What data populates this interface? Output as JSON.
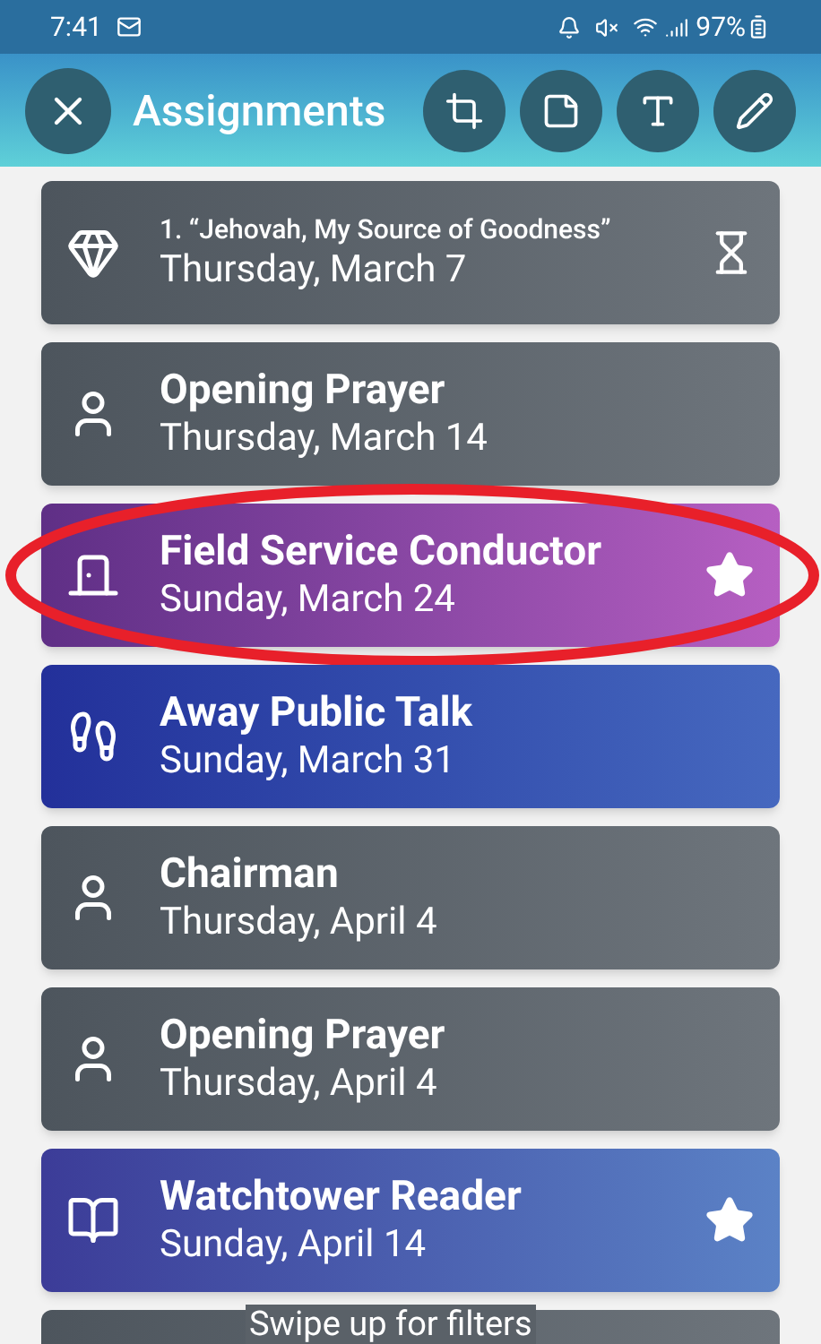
{
  "status_bar": {
    "time": "7:41",
    "battery": "97%"
  },
  "header": {
    "title": "Assignments"
  },
  "assignments": [
    {
      "kind": "song",
      "title": "1. “Jehovah, My Source of Goodness”",
      "date": "Thursday, March 7",
      "pending": true,
      "starred": false,
      "highlighted": false
    },
    {
      "kind": "person",
      "title": "Opening Prayer",
      "date": "Thursday, March 14",
      "pending": false,
      "starred": false,
      "highlighted": false
    },
    {
      "kind": "service",
      "title": "Field Service Conductor",
      "date": "Sunday, March 24",
      "pending": false,
      "starred": true,
      "highlighted": true
    },
    {
      "kind": "away",
      "title": "Away Public Talk",
      "date": "Sunday, March 31",
      "pending": false,
      "starred": false,
      "highlighted": false
    },
    {
      "kind": "person",
      "title": "Chairman",
      "date": "Thursday, April 4",
      "pending": false,
      "starred": false,
      "highlighted": false
    },
    {
      "kind": "person",
      "title": "Opening Prayer",
      "date": "Thursday, April 4",
      "pending": false,
      "starred": false,
      "highlighted": false
    },
    {
      "kind": "reader",
      "title": "Watchtower Reader",
      "date": "Sunday, April 14",
      "pending": false,
      "starred": true,
      "highlighted": false
    }
  ],
  "hint": "Swipe up for filters"
}
